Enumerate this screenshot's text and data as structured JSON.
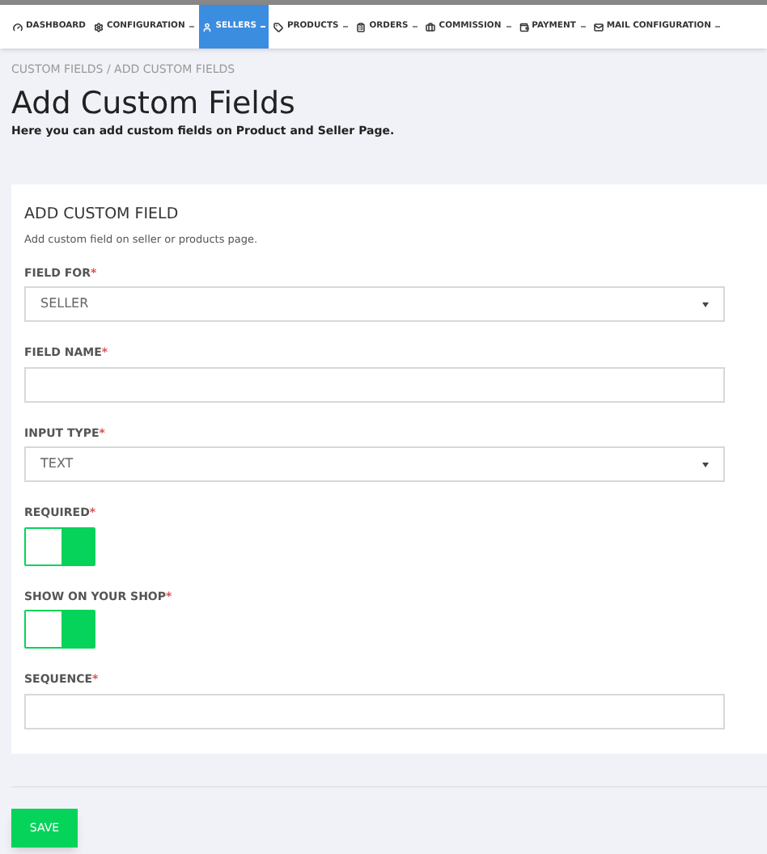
{
  "nav": [
    {
      "label": "DASHBOARD",
      "dropdown": false,
      "selected": false
    },
    {
      "label": "CONFIGURATION",
      "dropdown": true,
      "selected": false
    },
    {
      "label": "SELLERS",
      "dropdown": true,
      "selected": true
    },
    {
      "label": "PRODUCTS",
      "dropdown": true,
      "selected": false
    },
    {
      "label": "ORDERS",
      "dropdown": true,
      "selected": false
    },
    {
      "label": "COMMISSION",
      "dropdown": true,
      "selected": false
    },
    {
      "label": "PAYMENT",
      "dropdown": true,
      "selected": false
    },
    {
      "label": "MAIL CONFIGURATION",
      "dropdown": true,
      "selected": false
    }
  ],
  "breadcrumb": "CUSTOM FIELDS / ADD CUSTOM FIELDS",
  "page": {
    "title": "Add Custom Fields",
    "subtitle": "Here you can add custom fields on Product and Seller Page."
  },
  "card": {
    "title": "ADD CUSTOM FIELD",
    "description": "Add custom field on seller or products page.",
    "fields": [
      {
        "kind": "select",
        "label": "FIELD FOR",
        "mark": "*",
        "value": "SELLER"
      },
      {
        "kind": "text",
        "label": "FIELD NAME",
        "mark": "*"
      },
      {
        "kind": "select",
        "label": "INPUT TYPE",
        "mark": "*",
        "value": "TEXT"
      },
      {
        "kind": "toggle",
        "label": "REQUIRED",
        "mark": "*",
        "on": true
      },
      {
        "kind": "toggle",
        "label": "SHOW ON YOUR SHOP",
        "mark": "*",
        "on": true
      },
      {
        "kind": "text",
        "label": "SEQUENCE",
        "mark": "*"
      }
    ]
  },
  "save_button": "SAVE"
}
